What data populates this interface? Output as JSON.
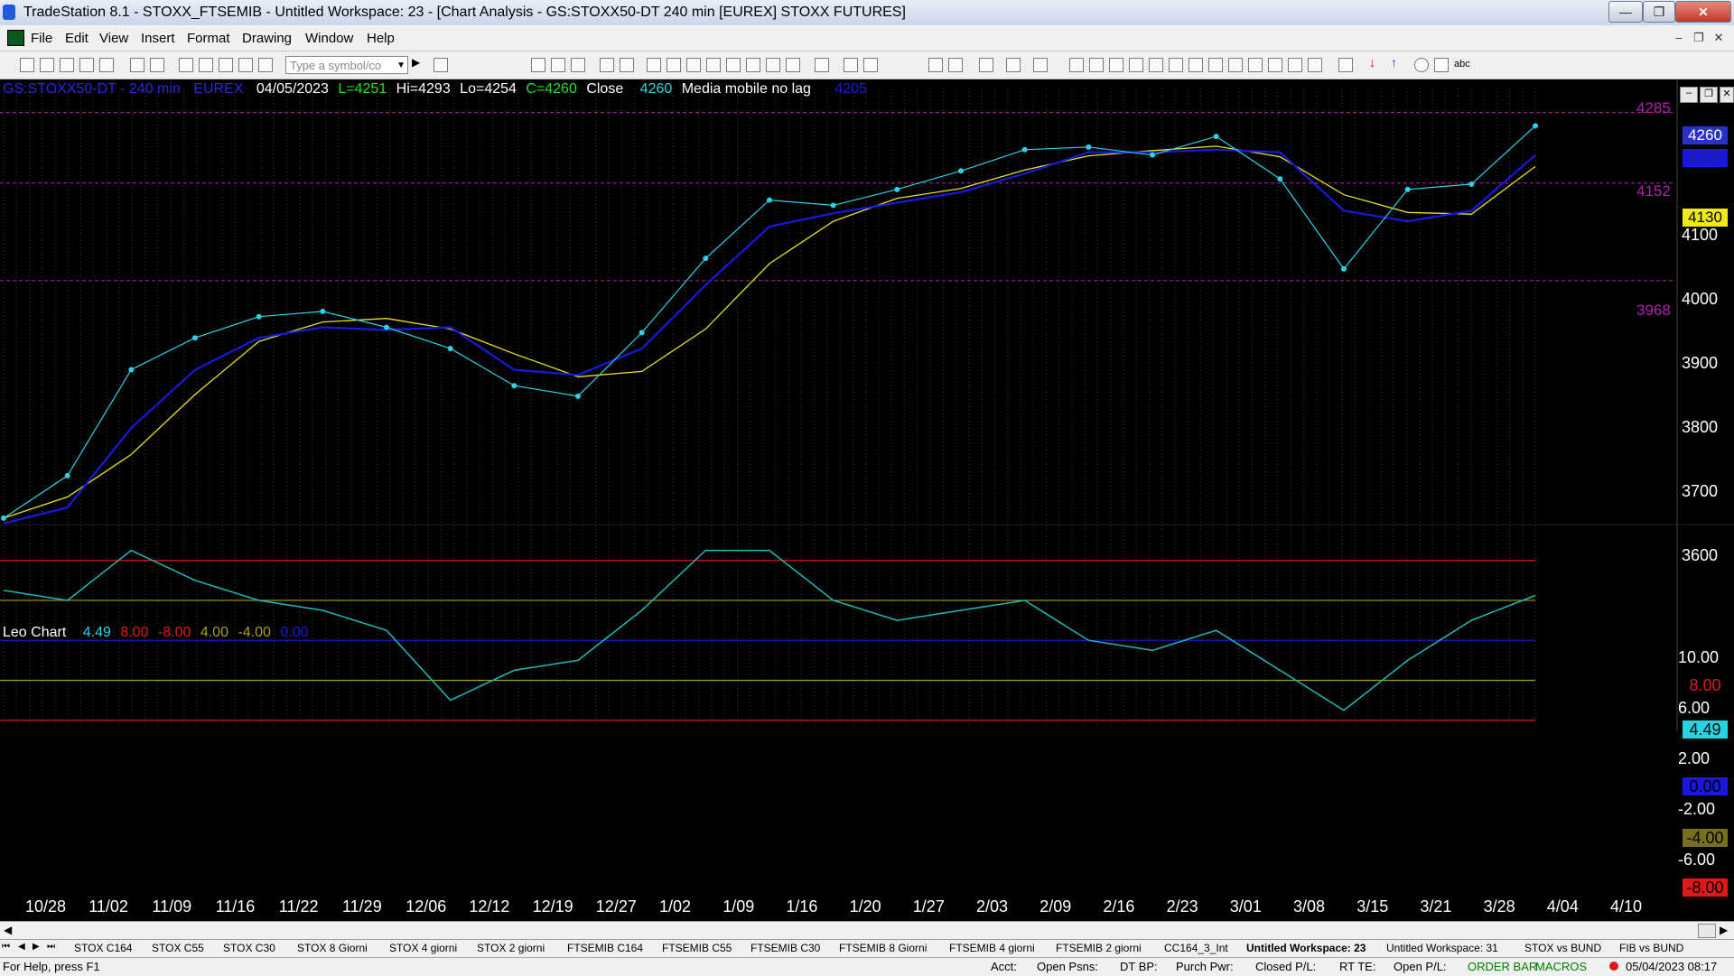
{
  "window": {
    "title": "TradeStation 8.1 - STOXX_FTSEMIB - Untitled Workspace:  23 - [Chart Analysis - GS:STOXX50-DT  240 min  [EUREX] STOXX FUTURES]"
  },
  "menu": [
    "File",
    "Edit",
    "View",
    "Insert",
    "Format",
    "Drawing",
    "Window",
    "Help"
  ],
  "toolbar": {
    "symbol_placeholder": "Type a symbol/co",
    "abc_label": "abc"
  },
  "chart": {
    "header": {
      "symbol": "GS:STOXX50-DT - 240 min",
      "exchange": "EUREX",
      "date": "04/05/2023",
      "last": "L=4251",
      "hi": "Hi=4293",
      "lo": "Lo=4254",
      "close_eq": "C=4260",
      "close_label": "Close",
      "close_value": "4260",
      "study_name": "Media mobile no lag",
      "study_value": "4205"
    },
    "price_labels": {
      "l4285": "4285",
      "l4152": "4152",
      "l3968": "3968"
    },
    "price_badges": {
      "last": "4260",
      "study": "4205",
      "yellow": "4130"
    },
    "price_axis": [
      "4100",
      "4000",
      "3900",
      "3800",
      "3700",
      "3600"
    ],
    "osc_header": {
      "name": "Leo Chart",
      "v1": "4.49",
      "v2": "8.00",
      "v3": "-8.00",
      "v4": "4.00",
      "v5": "-4.00",
      "v6": "0.00"
    },
    "osc_axis": [
      "10.00",
      "6.00",
      "2.00",
      "-2.00",
      "-6.00"
    ],
    "osc_badges": {
      "red_top": "8.00",
      "cyan": "4.49",
      "blue": "0.00",
      "olive": "-4.00",
      "red_bottom": "-8.00"
    },
    "date_axis": [
      "10/28",
      "11/02",
      "11/09",
      "11/16",
      "11/22",
      "11/29",
      "12/06",
      "12/12",
      "12/19",
      "12/27",
      "1/02",
      "1/09",
      "1/16",
      "1/20",
      "1/27",
      "2/03",
      "2/09",
      "2/16",
      "2/23",
      "3/01",
      "3/08",
      "3/15",
      "3/21",
      "3/28",
      "4/04",
      "4/10"
    ],
    "colors": {
      "price": "#29d3e6",
      "fast_ma": "#e8e020",
      "slow_ma": "#1818e0",
      "osc": "#20b8b8",
      "upper": "#e01818",
      "mid": "#a8a018",
      "zero": "#1818c8",
      "guide": "#b020b0"
    }
  },
  "chart_data": [
    {
      "type": "line",
      "title": "GS:STOXX50-DT - 240 min",
      "x": [
        "10/28",
        "11/02",
        "11/09",
        "11/16",
        "11/22",
        "11/29",
        "12/06",
        "12/12",
        "12/19",
        "12/27",
        "1/02",
        "1/09",
        "1/16",
        "1/20",
        "1/27",
        "2/03",
        "2/09",
        "2/16",
        "2/23",
        "3/01",
        "3/08",
        "3/15",
        "3/21",
        "3/28",
        "4/04"
      ],
      "series": [
        {
          "values": [
            3520,
            3600,
            3800,
            3860,
            3900,
            3910,
            3880,
            3840,
            3770,
            3750,
            3870,
            4010,
            4120,
            4110,
            4140,
            4175,
            4215,
            4220,
            4205,
            4240,
            4160,
            3990,
            4140,
            4150,
            4260
          ]
        },
        {
          "name": "Media mobile no lag",
          "values": [
            3510,
            3540,
            3690,
            3800,
            3860,
            3880,
            3875,
            3880,
            3800,
            3790,
            3840,
            3960,
            4070,
            4095,
            4115,
            4135,
            4170,
            4210,
            4210,
            4215,
            4210,
            4100,
            4080,
            4100,
            4205
          ]
        }
      ],
      "ylim": [
        3530,
        4310
      ]
    },
    {
      "type": "line",
      "title": "Leo Chart",
      "x": [
        "10/28",
        "11/02",
        "11/09",
        "11/16",
        "11/22",
        "11/29",
        "12/06",
        "12/12",
        "12/19",
        "12/27",
        "1/02",
        "1/09",
        "1/16",
        "1/20",
        "1/27",
        "2/03",
        "2/09",
        "2/16",
        "2/23",
        "3/01",
        "3/08",
        "3/15",
        "3/21",
        "3/28",
        "4/04"
      ],
      "series": [
        {
          "values": [
            5,
            4,
            9,
            6,
            4,
            3,
            1,
            -6,
            -3,
            -2,
            3,
            9,
            9,
            4,
            2,
            3,
            4,
            0,
            -1,
            1,
            -3,
            -7,
            -2,
            2,
            4.49
          ]
        }
      ],
      "ylim": [
        -8.2,
        10.5
      ]
    }
  ],
  "tabs": [
    {
      "label": "STOX C164"
    },
    {
      "label": "STOX C55"
    },
    {
      "label": "STOX  C30"
    },
    {
      "label": "STOX  8 Giorni"
    },
    {
      "label": "STOX 4 giorni"
    },
    {
      "label": "STOX  2 giorni"
    },
    {
      "label": "FTSEMIB C164"
    },
    {
      "label": "FTSEMIB C55"
    },
    {
      "label": "FTSEMIB C30"
    },
    {
      "label": "FTSEMIB  8 Giorni"
    },
    {
      "label": "FTSEMIB  4 giorni"
    },
    {
      "label": "FTSEMIB  2 giorni"
    },
    {
      "label": "CC164_3_Int"
    },
    {
      "label": "Untitled Workspace:  23",
      "active": true
    },
    {
      "label": "Untitled Workspace:  31"
    },
    {
      "label": "STOX vs BUND"
    },
    {
      "label": "FIB vs BUND"
    }
  ],
  "status": {
    "help": "For Help, press F1",
    "acct": "Acct:",
    "open_psns": "Open Psns:",
    "dt_bp": "DT BP:",
    "purch_pwr": "Purch Pwr:",
    "closed_pl": "Closed P/L:",
    "rt_te": "RT TE:",
    "open_pl": "Open P/L:",
    "order_bar": "ORDER BAR",
    "macros": "MACROS",
    "datetime": "05/04/2023 08:17"
  }
}
